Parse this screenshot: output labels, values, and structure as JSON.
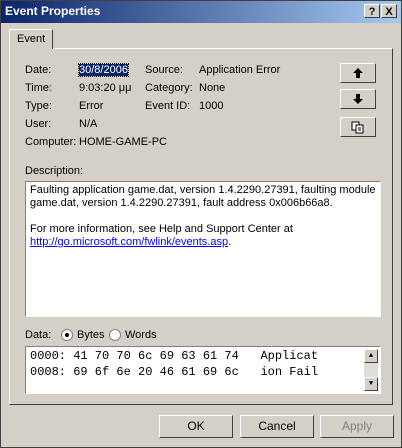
{
  "window": {
    "title": "Event Properties",
    "help_glyph": "?",
    "close_glyph": "X"
  },
  "tabs": [
    {
      "label": "Event"
    }
  ],
  "event": {
    "date_label": "Date:",
    "date": "30/8/2006",
    "time_label": "Time:",
    "time": "9:03:20 μμ",
    "type_label": "Type:",
    "type": "Error",
    "user_label": "User:",
    "user": "N/A",
    "computer_label": "Computer:",
    "computer": "HOME-GAME-PC",
    "source_label": "Source:",
    "source": "Application Error",
    "category_label": "Category:",
    "category": "None",
    "eventid_label": "Event ID:",
    "event_id": "1000"
  },
  "nav_buttons": {
    "up_icon": "arrow-up",
    "down_icon": "arrow-down",
    "copy_icon": "copy"
  },
  "description": {
    "label": "Description:",
    "line1": "Faulting application game.dat, version 1.4.2290.27391, faulting module",
    "line2": "game.dat, version 1.4.2290.27391, fault address 0x006b66a8.",
    "line3": "For more information, see Help and Support Center at",
    "link": "http://go.microsoft.com/fwlink/events.asp",
    "link_suffix": "."
  },
  "data_section": {
    "label": "Data:",
    "bytes_label": "Bytes",
    "words_label": "Words",
    "selected": "Bytes",
    "lines": [
      "0000: 41 70 70 6c 69 63 61 74   Applicat",
      "0008: 69 6f 6e 20 46 61 69 6c   ion Fail"
    ]
  },
  "buttons": {
    "ok": "OK",
    "cancel": "Cancel",
    "apply": "Apply"
  }
}
